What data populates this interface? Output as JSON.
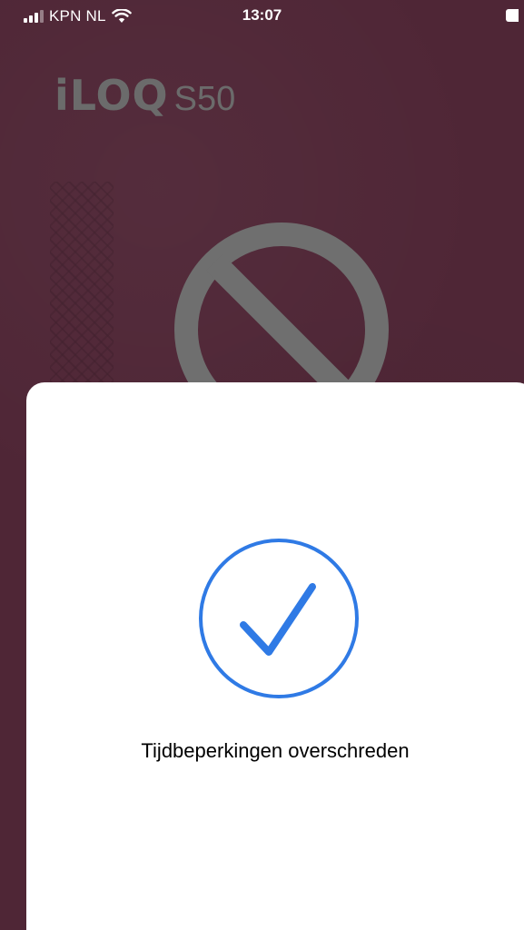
{
  "status_bar": {
    "carrier": "KPN NL",
    "time": "13:07"
  },
  "logo": {
    "brand": "iLOQ",
    "model": "S50"
  },
  "sheet": {
    "message": "Tijdbeperkingen overschreden"
  },
  "icons": {
    "signal": "signal-icon",
    "wifi": "wifi-icon",
    "battery": "battery-icon",
    "prohibited": "prohibited-icon",
    "success": "checkmark-circle-icon"
  },
  "colors": {
    "background": "#4f2636",
    "accent": "#2f7ae5",
    "logo_gray": "#6b6b6b",
    "sheet": "#ffffff"
  }
}
